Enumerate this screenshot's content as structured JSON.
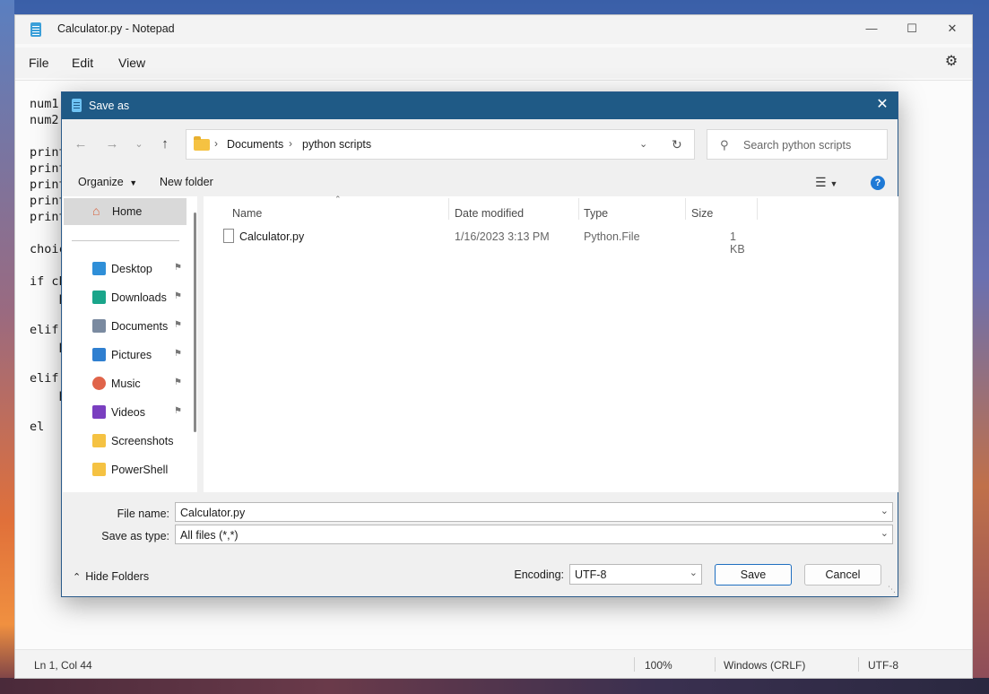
{
  "notepad": {
    "title": "Calculator.py - Notepad",
    "menu": [
      "File",
      "Edit",
      "View"
    ],
    "code_lines": [
      "num1",
      "num2",
      "",
      "print",
      "print",
      "print",
      "print",
      "print",
      "",
      "choic",
      "",
      "if ch",
      "    p",
      "",
      "elif",
      "    p",
      "",
      "elif",
      "    p",
      "",
      "el"
    ],
    "status": {
      "position": "Ln 1, Col 44",
      "zoom": "100%",
      "line_ending": "Windows (CRLF)",
      "encoding": "UTF-8"
    }
  },
  "dialog": {
    "title": "Save as",
    "address": {
      "crumbs": [
        "Documents",
        "python scripts"
      ]
    },
    "search": {
      "placeholder": "Search python scripts"
    },
    "toolbar": {
      "organize": "Organize",
      "new_folder": "New folder"
    },
    "nav": {
      "home": "Home",
      "items": [
        {
          "label": "Desktop",
          "icon": "desktop-icon",
          "color": "#2f8fd8",
          "pinned": true
        },
        {
          "label": "Downloads",
          "icon": "download-icon",
          "color": "#1aa58a",
          "pinned": true
        },
        {
          "label": "Documents",
          "icon": "document-icon",
          "color": "#7a8aa0",
          "pinned": true
        },
        {
          "label": "Pictures",
          "icon": "pictures-icon",
          "color": "#2f7fd0",
          "pinned": true
        },
        {
          "label": "Music",
          "icon": "music-icon",
          "color": "#e0644a",
          "pinned": true
        },
        {
          "label": "Videos",
          "icon": "videos-icon",
          "color": "#7a3fc0",
          "pinned": true
        },
        {
          "label": "Screenshots",
          "icon": "folder-icon",
          "color": "#f5c242",
          "pinned": false
        },
        {
          "label": "PowerShell",
          "icon": "folder-icon",
          "color": "#f5c242",
          "pinned": false
        }
      ]
    },
    "columns": [
      "Name",
      "Date modified",
      "Type",
      "Size"
    ],
    "files": [
      {
        "name": "Calculator.py",
        "date": "1/16/2023 3:13 PM",
        "type": "Python.File",
        "size": "1 KB"
      }
    ],
    "form": {
      "file_name_label": "File name:",
      "file_name_value": "Calculator.py",
      "type_label": "Save as type:",
      "type_value": "All files  (*,*)",
      "encoding_label": "Encoding:",
      "encoding_value": "UTF-8"
    },
    "buttons": {
      "hide_folders": "Hide Folders",
      "save": "Save",
      "cancel": "Cancel"
    }
  }
}
